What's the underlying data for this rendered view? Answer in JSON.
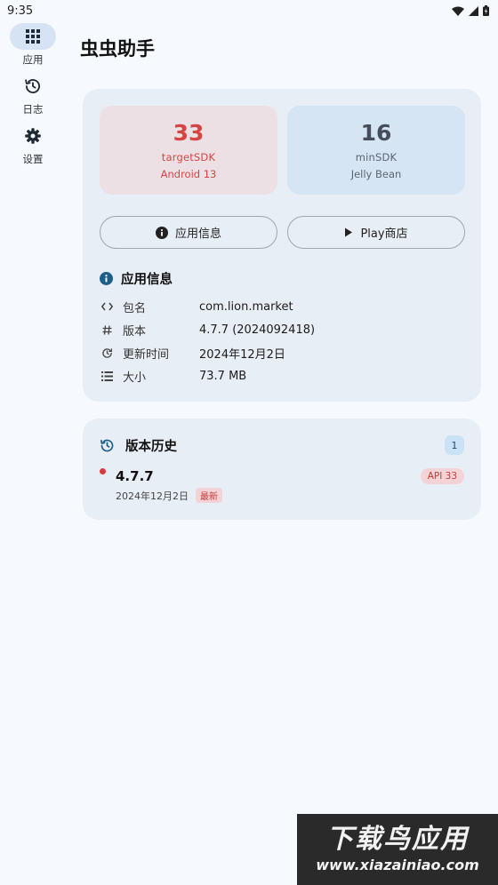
{
  "status_bar": {
    "time": "9:35"
  },
  "nav": {
    "items": [
      {
        "label": "应用",
        "icon": "apps-grid-icon",
        "active": true
      },
      {
        "label": "日志",
        "icon": "history-icon",
        "active": false
      },
      {
        "label": "设置",
        "icon": "gear-icon",
        "active": false
      }
    ]
  },
  "header": {
    "title": "虫虫助手"
  },
  "sdk": {
    "target": {
      "value": "33",
      "label": "targetSDK",
      "version": "Android 13"
    },
    "min": {
      "value": "16",
      "label": "minSDK",
      "version": "Jelly Bean"
    }
  },
  "buttons": {
    "app_info": "应用信息",
    "play_store": "Play商店"
  },
  "app_info": {
    "title": "应用信息",
    "rows": [
      {
        "icon": "code-icon",
        "label": "包名",
        "value": "com.lion.market"
      },
      {
        "icon": "hash-icon",
        "label": "版本",
        "value": "4.7.7 (2024092418)"
      },
      {
        "icon": "update-clock-icon",
        "label": "更新时间",
        "value": "2024年12月2日"
      },
      {
        "icon": "list-icon",
        "label": "大小",
        "value": "73.7 MB"
      }
    ]
  },
  "history": {
    "title": "版本历史",
    "count": "1",
    "entries": [
      {
        "version": "4.7.7",
        "date": "2024年12月2日",
        "tag": "最新",
        "api": "API 33"
      }
    ]
  },
  "watermark": {
    "cn": "下载鸟应用",
    "url": "www.xiazainiao.com"
  },
  "colors": {
    "accent_red": "#d64541",
    "accent_blue": "#d5e5f4",
    "surface": "#e8eef5"
  }
}
